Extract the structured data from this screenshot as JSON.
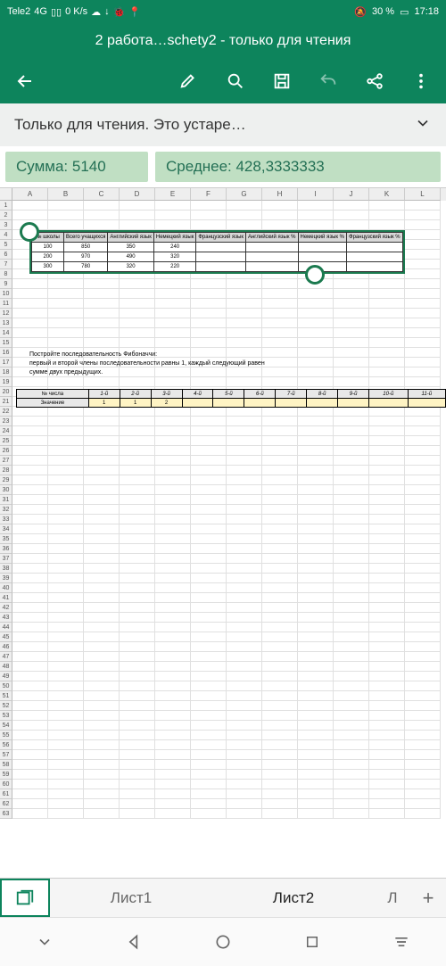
{
  "status": {
    "carrier": "Tele2",
    "network": "4G",
    "speed": "0 K/s",
    "battery_pct": "30 %",
    "time": "17:18"
  },
  "title": "2 работа…schety2 - только для чтения",
  "banner": "Только для чтения. Это устаре…",
  "stats": {
    "sum_label": "Сумма: 5140",
    "avg_label": "Среднее: 428,3333333"
  },
  "columns": [
    "A",
    "B",
    "C",
    "D",
    "E",
    "F",
    "G",
    "H",
    "I",
    "J",
    "K",
    "L"
  ],
  "table1": {
    "headers": [
      "№ школы",
      "Всего учащихся",
      "Английский язык",
      "Немецкий язык",
      "Французский язык",
      "Английский язык %",
      "Немецкий язык %",
      "Французский язык %"
    ],
    "rows": [
      [
        "100",
        "850",
        "350",
        "240",
        "",
        "",
        "",
        ""
      ],
      [
        "200",
        "970",
        "490",
        "320",
        "",
        "",
        "",
        ""
      ],
      [
        "300",
        "780",
        "320",
        "220",
        "",
        "",
        "",
        ""
      ]
    ]
  },
  "fib": {
    "line1": "Постройте последовательность Фибоначчи:",
    "line2": "первый и второй члены последовательности равны 1, каждый следующий равен",
    "line3": "сумме двух предыдущих."
  },
  "table2": {
    "row_label1": "№ числа",
    "row_label2": "Значение",
    "headers": [
      "1-й",
      "2-й",
      "3-й",
      "4-й",
      "5-й",
      "6-й",
      "7-й",
      "8-й",
      "9-й",
      "10-й",
      "11-й"
    ],
    "values": [
      "1",
      "1",
      "2",
      "",
      "",
      "",
      "",
      "",
      "",
      "",
      ""
    ]
  },
  "tabs": {
    "t1": "Лист1",
    "t2": "Лист2",
    "t3": "Л"
  }
}
